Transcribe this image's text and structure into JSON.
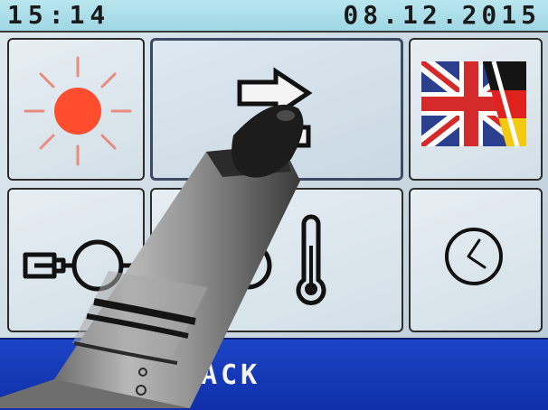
{
  "status_bar": {
    "time": "15:14",
    "date": "08.12.2015"
  },
  "tiles": [
    {
      "icon": "sun-icon"
    },
    {
      "icon": "arrows-icon"
    },
    {
      "icon": "uk-germany-flag-icon"
    },
    {
      "icon": "sensor-probe-icon"
    },
    {
      "icon": "temperature-icon"
    },
    {
      "icon": "clock-icon"
    }
  ],
  "footer": {
    "back_label": "BACK"
  },
  "colors": {
    "status_bar": "#a8dde8",
    "footer": "#1638b8",
    "sun": "#ff4d2e",
    "sun_rays": "#e88c80"
  }
}
